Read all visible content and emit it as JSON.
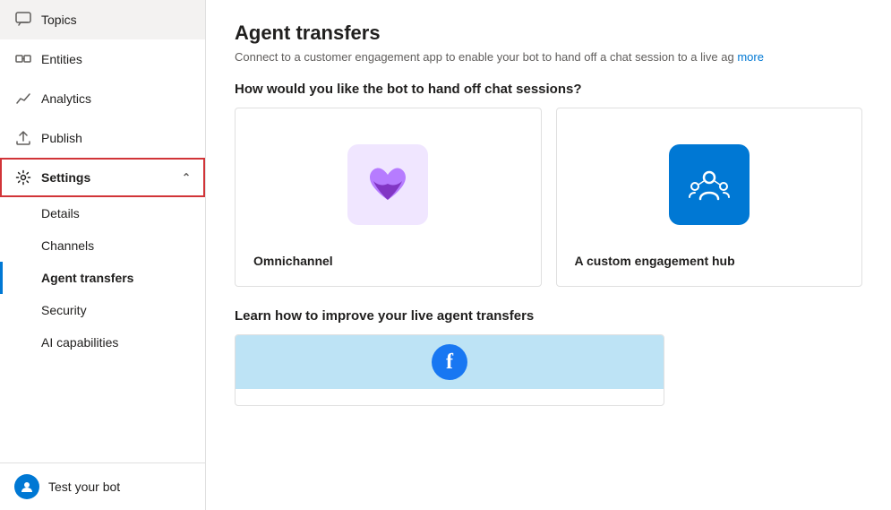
{
  "sidebar": {
    "items": [
      {
        "id": "topics",
        "label": "Topics",
        "icon": "chat-icon"
      },
      {
        "id": "entities",
        "label": "Entities",
        "icon": "entities-icon"
      },
      {
        "id": "analytics",
        "label": "Analytics",
        "icon": "analytics-icon"
      },
      {
        "id": "publish",
        "label": "Publish",
        "icon": "publish-icon"
      },
      {
        "id": "settings",
        "label": "Settings",
        "icon": "settings-icon",
        "expanded": true
      }
    ],
    "sub_items": [
      {
        "id": "details",
        "label": "Details"
      },
      {
        "id": "channels",
        "label": "Channels"
      },
      {
        "id": "agent-transfers",
        "label": "Agent transfers",
        "active": true
      },
      {
        "id": "security",
        "label": "Security"
      },
      {
        "id": "ai-capabilities",
        "label": "AI capabilities"
      }
    ],
    "test_bot": {
      "label": "Test your bot"
    }
  },
  "main": {
    "title": "Agent transfers",
    "description": "Connect to a customer engagement app to enable your bot to hand off a chat session to a live ag",
    "description_link": "more",
    "section1_title": "How would you like the bot to hand off chat sessions?",
    "section2_title": "Learn how to improve your live agent transfers",
    "card1_label": "Omnichannel",
    "card2_label": "A custom engagement hub"
  }
}
